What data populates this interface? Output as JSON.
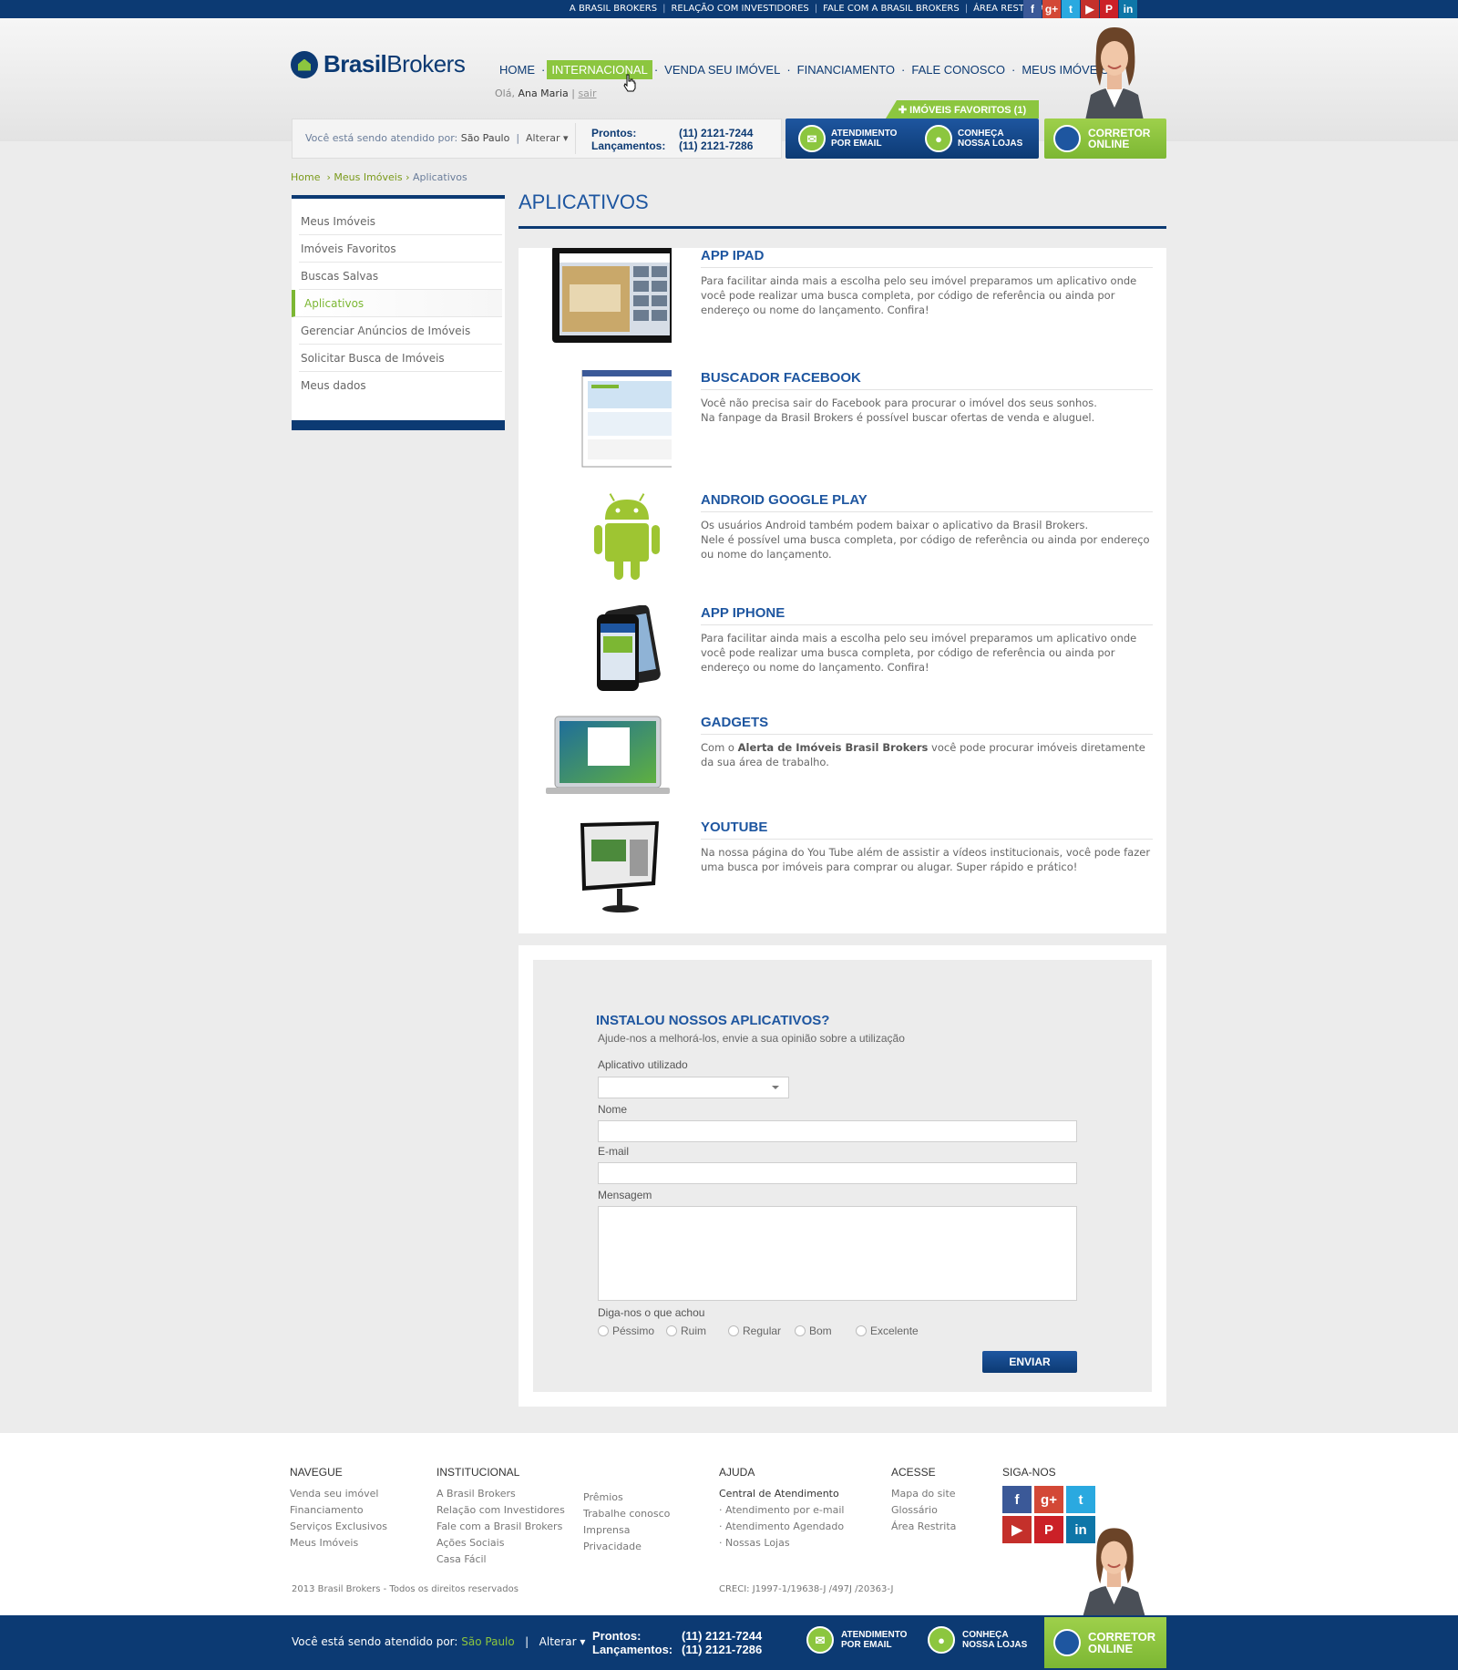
{
  "topbar": {
    "links": [
      "A BRASIL BROKERS",
      "RELAÇÃO COM INVESTIDORES",
      "FALE COM A BRASIL BROKERS",
      "ÁREA RESTRITA"
    ],
    "social": [
      {
        "icon": "facebook-icon",
        "glyph": "f",
        "color": "#3b5998"
      },
      {
        "icon": "googleplus-icon",
        "glyph": "g+",
        "color": "#d34836"
      },
      {
        "icon": "twitter-icon",
        "glyph": "t",
        "color": "#2aa9e0"
      },
      {
        "icon": "youtube-icon",
        "glyph": "▶",
        "color": "#c4302b"
      },
      {
        "icon": "pinterest-icon",
        "glyph": "P",
        "color": "#cb2027"
      },
      {
        "icon": "linkedin-icon",
        "glyph": "in",
        "color": "#0e76a8"
      }
    ]
  },
  "header": {
    "logo_bold": "Brasil",
    "logo_regular": "Brokers",
    "nav": [
      "HOME",
      "INTERNACIONAL",
      "VENDA SEU IMÓVEL",
      "FINANCIAMENTO",
      "FALE CONOSCO",
      "MEUS IMÓVEIS"
    ],
    "nav_active_index": 1,
    "greeting": "Olá,",
    "user_name": "Ana Maria",
    "logout": "sair",
    "favorites_tab": "✚ IMÓVEIS FAVORITOS (1)"
  },
  "service_bar": {
    "who_label": "Você está sendo atendido por:",
    "city": "São Paulo",
    "change": "Alterar",
    "prontos_label": "Prontos:",
    "prontos_phone": "(11) 2121-7244",
    "lanc_label": "Lançamentos:",
    "lanc_phone": "(11) 2121-7286",
    "email_btn_1": "ATENDIMENTO",
    "email_btn_2": "POR EMAIL",
    "stores_btn_1": "CONHEÇA",
    "stores_btn_2": "NOSSA LOJAS",
    "corretor_1": "CORRETOR",
    "corretor_2": "ONLINE"
  },
  "breadcrumb": {
    "home": "Home",
    "parent": "Meus Imóveis",
    "current": "Aplicativos"
  },
  "sidebar": {
    "items": [
      "Meus Imóveis",
      "Imóveis Favoritos",
      "Buscas Salvas",
      "Aplicativos",
      "Gerenciar Anúncios de Imóveis",
      "Solicitar Busca de Imóveis",
      "Meus dados"
    ],
    "active_index": 3
  },
  "page_title": "APLICATIVOS",
  "apps": [
    {
      "title": "APP IPAD",
      "text": "Para facilitar ainda mais a escolha pelo seu imóvel preparamos um aplicativo onde você pode realizar uma busca completa, por código de referência ou ainda por endereço ou nome do lançamento. Confira!"
    },
    {
      "title": "BUSCADOR FACEBOOK",
      "text": "Você não precisa sair do Facebook para procurar o imóvel dos seus sonhos.\nNa fanpage da Brasil Brokers é possível buscar ofertas de venda e aluguel."
    },
    {
      "title": "ANDROID GOOGLE PLAY",
      "text": "Os usuários Android também podem baixar o aplicativo da Brasil Brokers.\nNele é possível uma busca completa, por código de referência ou ainda por endereço ou nome do lançamento."
    },
    {
      "title": "APP IPHONE",
      "text": "Para facilitar ainda mais a escolha pelo seu imóvel preparamos um aplicativo onde você pode realizar uma busca completa, por código de referência ou ainda por endereço ou nome do lançamento. Confira!"
    },
    {
      "title": "GADGETS",
      "text_pre": "Com o ",
      "text_bold": "Alerta de Imóveis Brasil Brokers",
      "text_post": " você pode procurar imóveis diretamente da sua área de trabalho."
    },
    {
      "title": "YOUTUBE",
      "text": "Na nossa página do You Tube além de assistir a vídeos institucionais, você pode fazer uma busca por imóveis para comprar ou alugar. Super rápido e prático!"
    }
  ],
  "form": {
    "title": "INSTALOU NOSSOS APLICATIVOS?",
    "subtitle": "Ajude-nos a melhorá-los, envie a sua opinião sobre a utilização",
    "app_label": "Aplicativo utilizado",
    "name_label": "Nome",
    "email_label": "E-mail",
    "message_label": "Mensagem",
    "rating_label": "Diga-nos o que achou",
    "ratings": [
      "Péssimo",
      "Ruim",
      "Regular",
      "Bom",
      "Excelente"
    ],
    "submit": "ENVIAR"
  },
  "footer": {
    "navegue": {
      "title": "NAVEGUE",
      "links": [
        "Venda seu imóvel",
        "Financiamento",
        "Serviços Exclusivos",
        "Meus Imóveis"
      ]
    },
    "institucional": {
      "title": "INSTITUCIONAL",
      "links_a": [
        "A Brasil Brokers",
        "Relação com Investidores",
        "Fale com a Brasil Brokers",
        "Ações Sociais",
        "Casa Fácil"
      ],
      "links_b": [
        "Prêmios",
        "Trabalhe conosco",
        "Imprensa",
        "Privacidade"
      ]
    },
    "ajuda": {
      "title": "AJUDA",
      "head": "Central de Atendimento",
      "links": [
        "· Atendimento por e-mail",
        "· Atendimento Agendado",
        "· Nossas Lojas"
      ]
    },
    "acesse": {
      "title": "ACESSE",
      "links": [
        "Mapa do site",
        "Glossário",
        "Área Restrita"
      ]
    },
    "siga": {
      "title": "SIGA-NOS"
    },
    "copyright": "2013 Brasil Brokers - Todos os direitos reservados",
    "creci": "CRECI: J1997-1/19638-J /497J /20363-J"
  }
}
